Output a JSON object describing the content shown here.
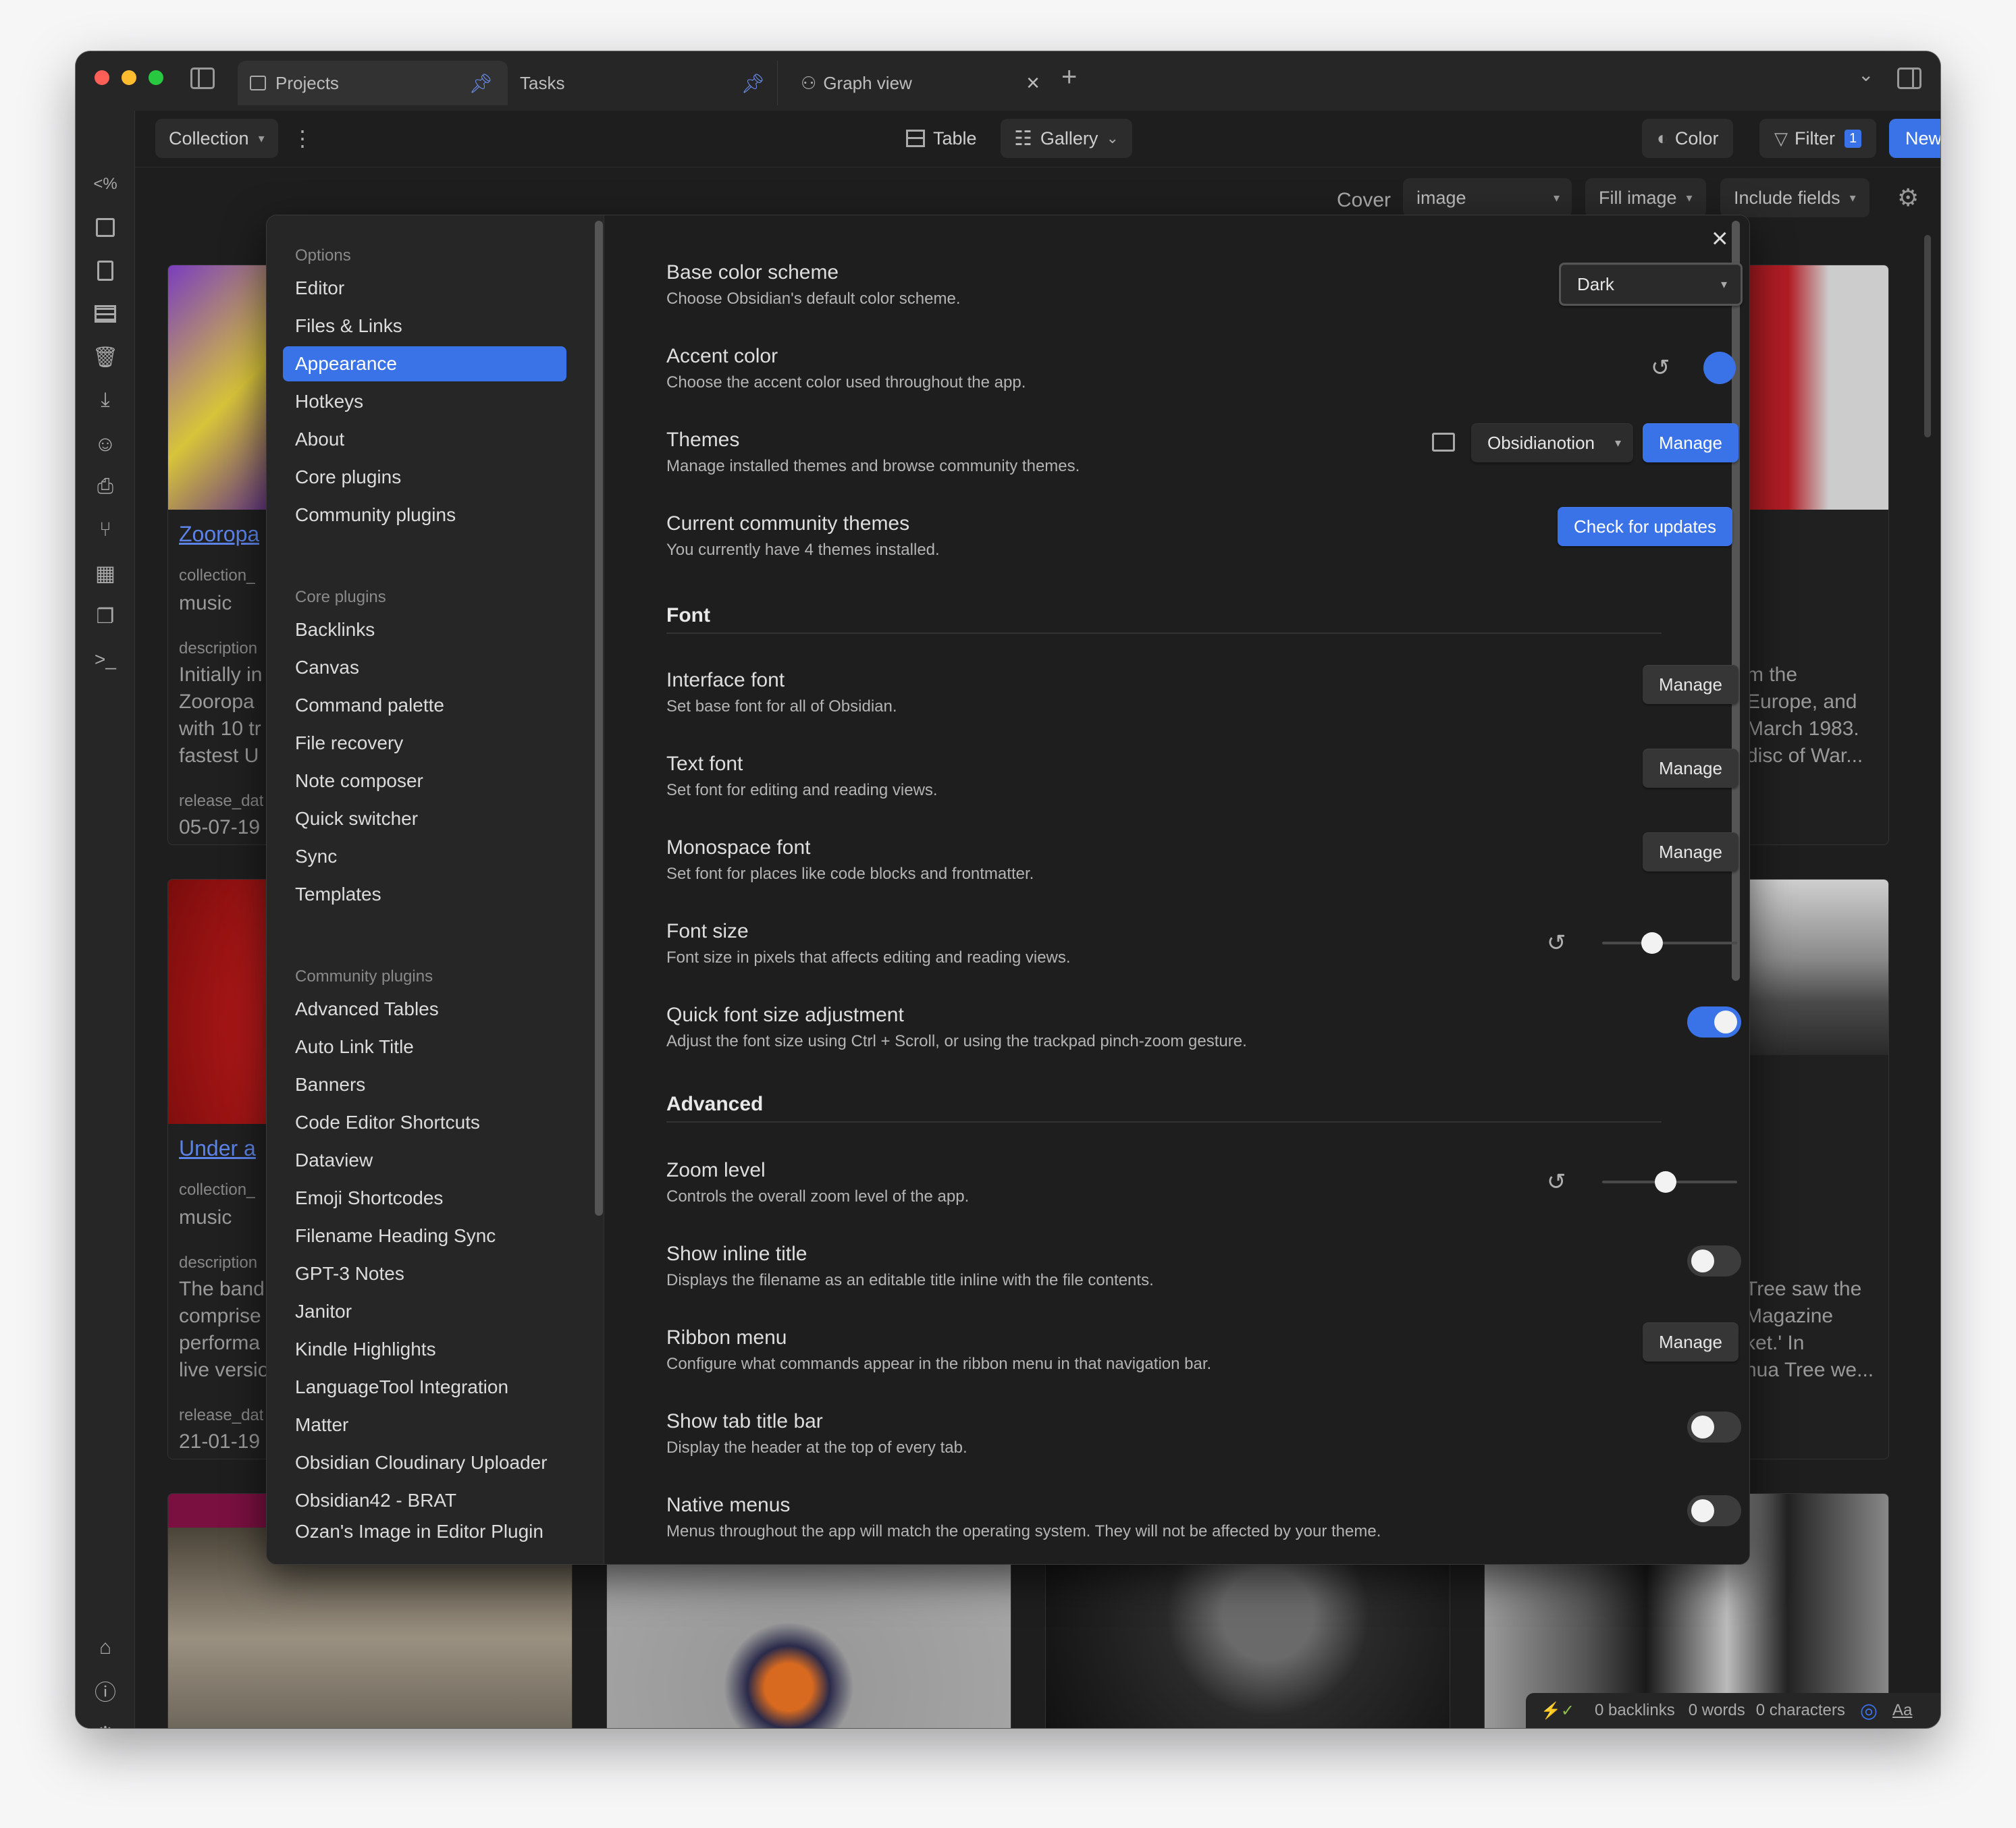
{
  "tabs": [
    {
      "label": "Projects"
    },
    {
      "label": "Tasks"
    },
    {
      "label": "Graph view"
    }
  ],
  "toolbar": {
    "collection_label": "Collection",
    "table_label": "Table",
    "gallery_label": "Gallery",
    "color_label": "Color",
    "filter_label": "Filter",
    "filter_count": "1",
    "new_label": "New"
  },
  "subbar": {
    "cover_label": "Cover",
    "cover_value": "image",
    "fill_label": "Fill image",
    "include_label": "Include fields"
  },
  "cards": {
    "c1_title": "Zooropa",
    "c1_collection_label": "collection_",
    "c1_collection": "music",
    "c1_desc_label": "description",
    "c1_desc_1": "Initially in",
    "c1_desc_2": "Zooropa",
    "c1_desc_3": "with 10 tr",
    "c1_desc_4": "fastest U",
    "c1_release_label": "release_dat",
    "c1_release": "05-07-19",
    "c2_title": "Under a",
    "c2_collection_label": "collection_",
    "c2_collection": "music",
    "c2_desc_label": "description",
    "c2_desc_1": "The band",
    "c2_desc_2": "comprise",
    "c2_desc_3": "performa",
    "c2_desc_4": "live versio",
    "c2_release_label": "release_dat",
    "c2_release": "21-01-19",
    "r1_desc_1": "m the",
    "r1_desc_2": "Europe, and",
    "r1_desc_3": "March 1983.",
    "r1_desc_4": "disc of War...",
    "r2_desc_1": "Tree saw the",
    "r2_desc_2": "Magazine",
    "r2_desc_3": "ket.' In",
    "r2_desc_4": "hua Tree we..."
  },
  "sidebar": {
    "groups": [
      "Options",
      "Core plugins",
      "Community plugins"
    ],
    "options": [
      "Editor",
      "Files & Links",
      "Appearance",
      "Hotkeys",
      "About",
      "Core plugins",
      "Community plugins"
    ],
    "core": [
      "Backlinks",
      "Canvas",
      "Command palette",
      "File recovery",
      "Note composer",
      "Quick switcher",
      "Sync",
      "Templates"
    ],
    "community": [
      "Advanced Tables",
      "Auto Link Title",
      "Banners",
      "Code Editor Shortcuts",
      "Dataview",
      "Emoji Shortcodes",
      "Filename Heading Sync",
      "GPT-3 Notes",
      "Janitor",
      "Kindle Highlights",
      "LanguageTool Integration",
      "Matter",
      "Obsidian Cloudinary Uploader",
      "Obsidian42 - BRAT",
      "Ozan's Image in Editor Plugin"
    ]
  },
  "settings": {
    "base_name": "Base color scheme",
    "base_desc": "Choose Obsidian's default color scheme.",
    "base_value": "Dark",
    "accent_name": "Accent color",
    "accent_desc": "Choose the accent color used throughout the app.",
    "accent_color": "#3a73e8",
    "themes_name": "Themes",
    "themes_desc": "Manage installed themes and browse community themes.",
    "themes_value": "Obsidianotion",
    "manage_label": "Manage",
    "current_name": "Current community themes",
    "current_desc": "You currently have 4 themes installed.",
    "check_label": "Check for updates",
    "font_heading": "Font",
    "iface_name": "Interface font",
    "iface_desc": "Set base font for all of Obsidian.",
    "text_name": "Text font",
    "text_desc": "Set font for editing and reading views.",
    "mono_name": "Monospace font",
    "mono_desc": "Set font for places like code blocks and frontmatter.",
    "fsize_name": "Font size",
    "fsize_desc": "Font size in pixels that affects editing and reading views.",
    "fsize_level": 0.37,
    "quick_name": "Quick font size adjustment",
    "quick_desc": "Adjust the font size using Ctrl + Scroll, or using the trackpad pinch-zoom gesture.",
    "quick_on": true,
    "adv_heading": "Advanced",
    "zoom_name": "Zoom level",
    "zoom_desc": "Controls the overall zoom level of the app.",
    "zoom_level": 0.47,
    "inline_name": "Show inline title",
    "inline_desc": "Displays the filename as an editable title inline with the file contents.",
    "ribbon_name": "Ribbon menu",
    "ribbon_desc": "Configure what commands appear in the ribbon menu in that navigation bar.",
    "tabbar_name": "Show tab title bar",
    "tabbar_desc": "Display the header at the top of every tab.",
    "native_name": "Native menus",
    "native_desc": "Menus throughout the app will match the operating system. They will not be affected by your theme."
  },
  "status": {
    "backlinks": "0 backlinks",
    "words": "0 words",
    "characters": "0 characters",
    "aa": "Aa"
  }
}
